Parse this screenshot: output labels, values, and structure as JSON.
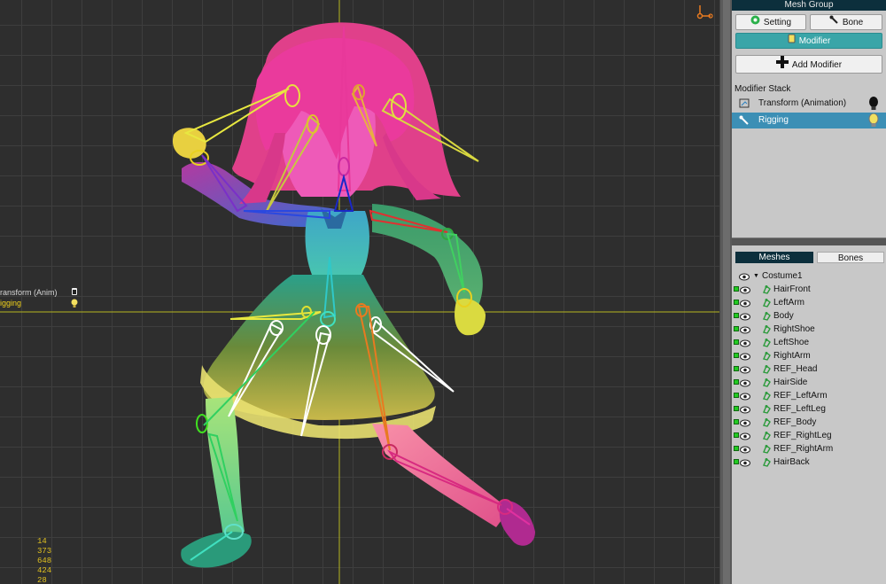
{
  "viewport": {
    "stack_items": [
      {
        "label": "ransform (Anim)",
        "color": "#d8d8d8"
      },
      {
        "label": "igging",
        "color": "#f2d21a"
      }
    ],
    "stats": [
      "14",
      "373",
      "648",
      "424",
      "28"
    ]
  },
  "panel": {
    "header": "Mesh Group",
    "setting_label": "Setting",
    "bone_label": "Bone",
    "modifier_label": "Modifier",
    "add_modifier_label": "Add Modifier",
    "modifier_stack_title": "Modifier Stack",
    "modifier_stack": [
      {
        "label": "Transform (Animation)",
        "selected": false
      },
      {
        "label": "Rigging",
        "selected": true
      }
    ],
    "tabs": {
      "meshes": "Meshes",
      "bones": "Bones"
    },
    "tree_root": "Costume1",
    "meshes": [
      "HairFront",
      "LeftArm",
      "Body",
      "RightShoe",
      "LeftShoe",
      "RightArm",
      "REF_Head",
      "HairSide",
      "REF_LeftArm",
      "REF_LeftLeg",
      "REF_Body",
      "REF_RightLeg",
      "REF_RightArm",
      "HairBack"
    ]
  },
  "colors": {
    "accent": "#3aa5a8",
    "selection": "#3c8fb5",
    "header": "#0c2f3c"
  }
}
